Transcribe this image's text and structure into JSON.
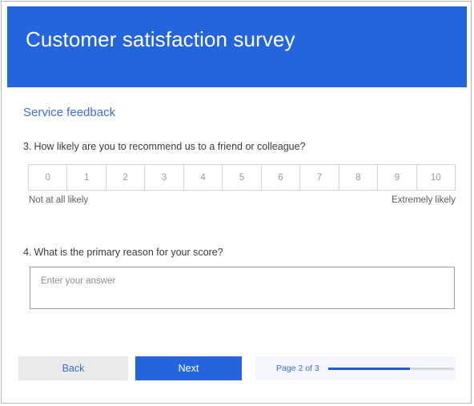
{
  "header": {
    "title": "Customer satisfaction survey",
    "background_color": "#2464DC",
    "title_color": "#ffffff"
  },
  "form": {
    "section_title": "Service feedback",
    "section_title_color": "#3A6FD8",
    "questions": [
      {
        "number": "3.",
        "text": "How likely are you to recommend us to a friend or colleague?",
        "type": "rating-scale",
        "scale": {
          "options": [
            "0",
            "1",
            "2",
            "3",
            "4",
            "5",
            "6",
            "7",
            "8",
            "9",
            "10"
          ],
          "low_label": "Not at all likely",
          "high_label": "Extremely likely",
          "selected": ""
        }
      },
      {
        "number": "4.",
        "text": "What is the primary reason for your score?",
        "type": "text",
        "answer": {
          "value": "",
          "placeholder": "Enter your answer"
        }
      }
    ]
  },
  "footer": {
    "back_label": "Back",
    "next_label": "Next",
    "back_color": "#eaeaea",
    "next_color": "#2464DC",
    "progress": {
      "text": "Page 2 of 3",
      "current_page": 2,
      "total_pages": 3,
      "percent": "65%",
      "fill_color": "#1a5bdd",
      "track_color": "#d8d8d8"
    }
  }
}
